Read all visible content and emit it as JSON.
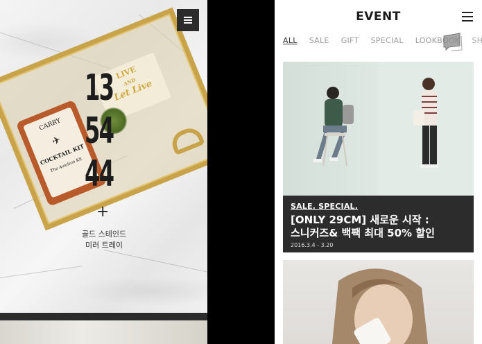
{
  "left_panel": {
    "product_number_lines": [
      "13",
      "54",
      "44"
    ],
    "plus_symbol": "+",
    "product_name_lines": [
      "골드 스테인드",
      "미러 트레이"
    ],
    "kit_card": {
      "line1": "CARRY",
      "line2": "COCKTAIL KIT",
      "line3": "The Aviation Kit"
    },
    "live_card": {
      "line1": "LIVE",
      "line2": "AND",
      "line3": "Let Live"
    }
  },
  "right_panel": {
    "brand": "EVENT",
    "tabs": [
      {
        "label": "ALL",
        "active": true
      },
      {
        "label": "SALE",
        "active": false
      },
      {
        "label": "GIFT",
        "active": false
      },
      {
        "label": "SPECIAL",
        "active": false
      },
      {
        "label": "LOOKBOOK",
        "active": false
      },
      {
        "label": "SHO",
        "active": false
      }
    ],
    "event1": {
      "tag": "SALE. SPECIAL.",
      "title_line1": "[ONLY 29CM] 새로운 시작 :",
      "title_line2": "스니커즈& 백팩 최대 50% 할인",
      "date": "2016.3.4 - 3.20"
    }
  },
  "colors": {
    "dark_bar": "#2b2b2b",
    "gold": "#c9a34a",
    "caption_bg": "#2c2c2c",
    "tab_active": "#333333",
    "tab_inactive": "#999999"
  }
}
